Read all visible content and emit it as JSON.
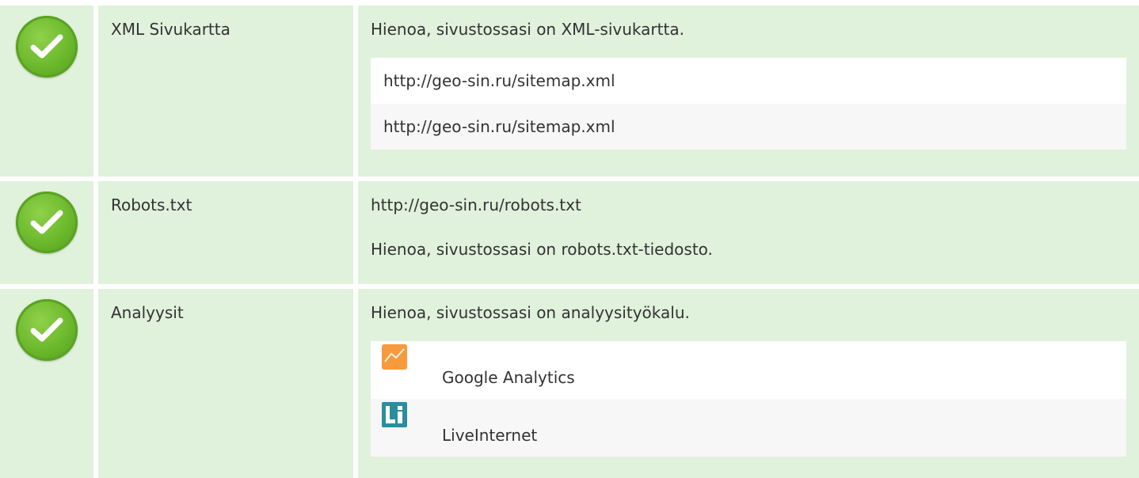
{
  "rows": [
    {
      "label": "XML Sivukartta",
      "message": "Hienoa, sivustossasi on XML-sivukartta.",
      "items": [
        "http://geo-sin.ru/sitemap.xml",
        "http://geo-sin.ru/sitemap.xml"
      ]
    },
    {
      "label": "Robots.txt",
      "lines": [
        "http://geo-sin.ru/robots.txt",
        "Hienoa, sivustossasi on robots.txt-tiedosto."
      ]
    },
    {
      "label": "Analyysit",
      "message": "Hienoa, sivustossasi on analyysityökalu.",
      "tools": [
        {
          "name": "Google Analytics",
          "icon": "google-analytics-icon"
        },
        {
          "name": "LiveInternet",
          "icon": "liveinternet-icon"
        }
      ]
    }
  ],
  "colors": {
    "row_bg": "#e0f1dc",
    "check_green": "#6bb82c",
    "ga_orange": "#f79a3e",
    "li_teal": "#2a8e9e"
  }
}
